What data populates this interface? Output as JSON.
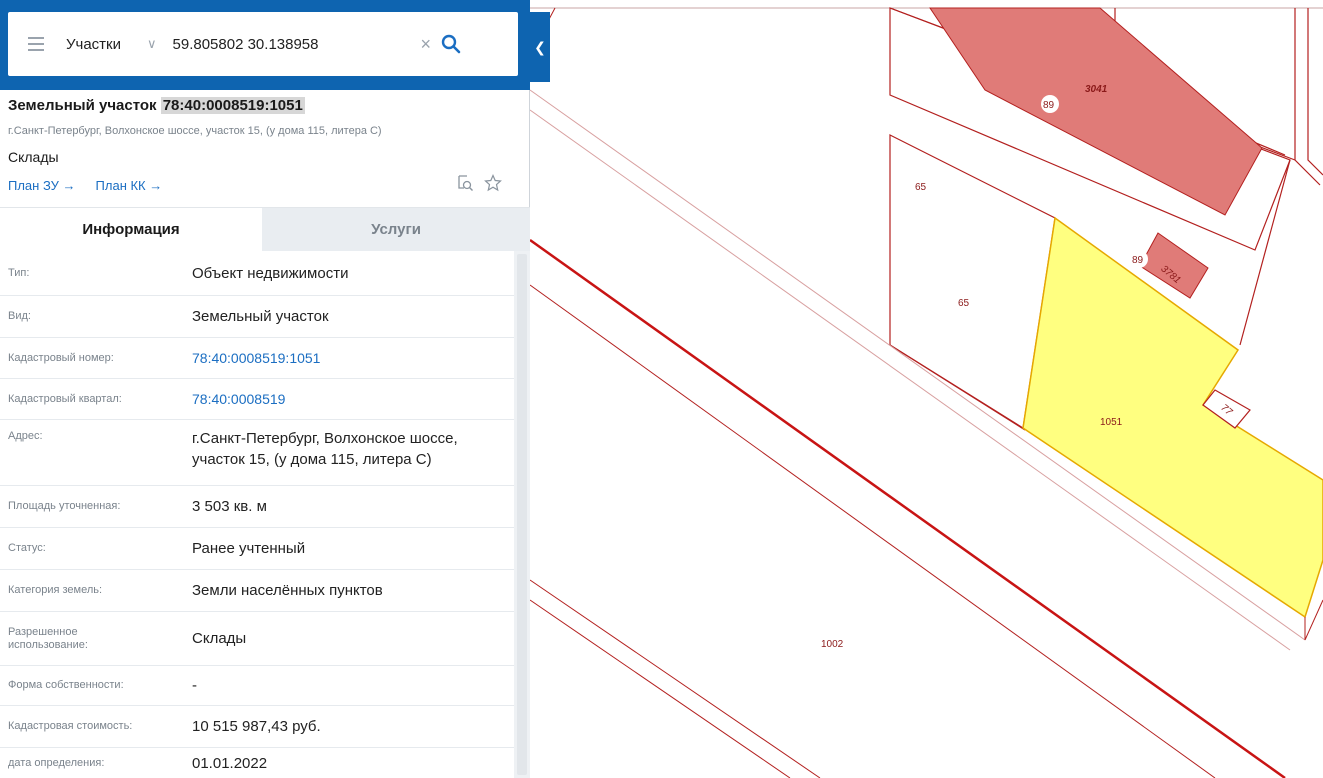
{
  "search": {
    "layer": "Участки",
    "query": "59.805802 30.138958"
  },
  "object": {
    "type_prefix": "Земельный участок",
    "cadastral": "78:40:0008519:1051",
    "address": "г.Санкт-Петербург, Волхонское шоссе, участок 15, (у дома 115, литера С)",
    "use": "Склады",
    "plan_zu": "План ЗУ →",
    "plan_kk": "План КК →"
  },
  "tabs": {
    "info": "Информация",
    "services": "Услуги"
  },
  "info_rows": [
    {
      "label": "Тип:",
      "value": "Объект недвижимости"
    },
    {
      "label": "Вид:",
      "value": "Земельный участок"
    },
    {
      "label": "Кадастровый номер:",
      "value": "78:40:0008519:1051"
    },
    {
      "label": "Кадастровый квартал:",
      "value": "78:40:0008519"
    },
    {
      "label": "Адрес:",
      "value_line1": "г.Санкт-Петербург, Волхонское шоссе,",
      "value_line2": "участок 15, (у дома 115, литера С)"
    },
    {
      "label": "Площадь уточненная:",
      "value": "3 503 кв. м"
    },
    {
      "label": "Статус:",
      "value": "Ранее учтенный"
    },
    {
      "label": "Категория земель:",
      "value": "Земли населённых пунктов"
    },
    {
      "label_line1": "Разрешенное",
      "label_line2": "использование:",
      "value": "Склады"
    },
    {
      "label": "Форма собственности:",
      "value": "-"
    },
    {
      "label": "Кадастровая стоимость:",
      "value": "10 515 987,43 руб."
    },
    {
      "label": "дата определения:",
      "value": "01.01.2022"
    }
  ],
  "map": {
    "labels": [
      "3041",
      "89",
      "65",
      "89",
      "3781",
      "65",
      "77",
      "1051",
      "1002"
    ],
    "colors": {
      "parcel_outline": "#b3201f",
      "parcel_fill_red": "#e07b78",
      "selected_fill": "#ffff80",
      "selected_outline": "#e6a800",
      "panel_header": "#0e64b0",
      "link": "#1b6ec2"
    }
  }
}
